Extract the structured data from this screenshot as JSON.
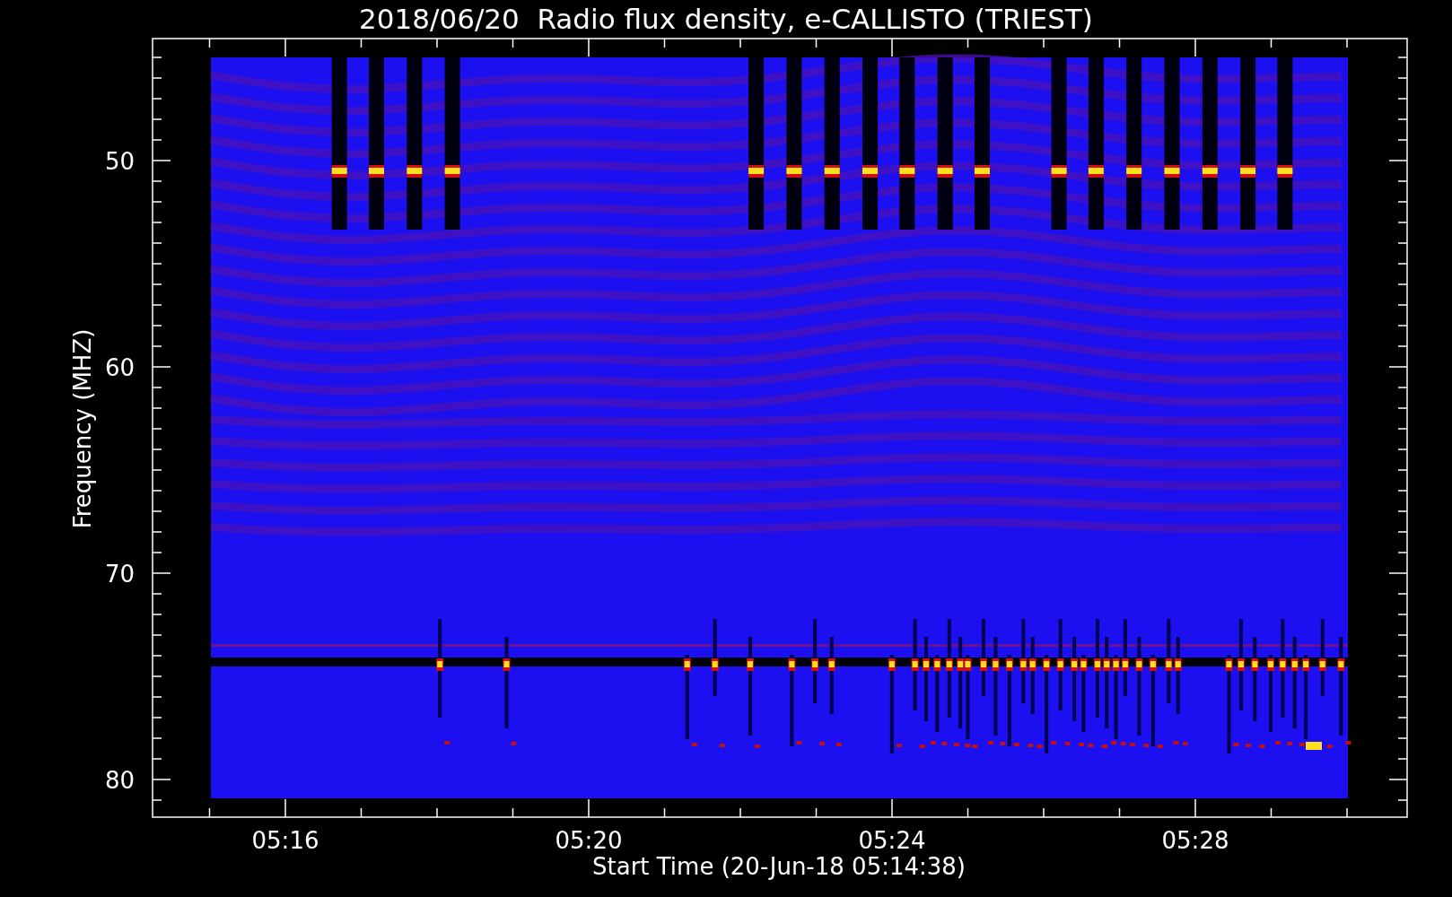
{
  "title": "2018/06/20  Radio flux density, e-CALLISTO (TRIEST)",
  "y_axis": {
    "label": "Frequency (MHZ)",
    "ticks": [
      "50",
      "60",
      "70",
      "80"
    ]
  },
  "x_axis": {
    "label": "Start Time (20-Jun-18 05:14:38)",
    "ticks": [
      "05:16",
      "05:20",
      "05:24",
      "05:28"
    ]
  }
}
